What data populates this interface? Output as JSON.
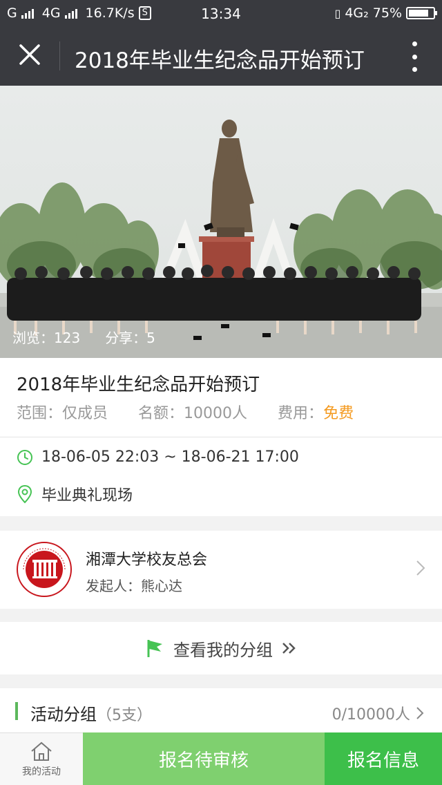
{
  "status_bar": {
    "carrier_1": "G",
    "carrier_2": "4G",
    "speed": "16.7K/s",
    "time": "13:34",
    "network": "4G₂",
    "battery": "75%",
    "battery_level": 0.75
  },
  "nav": {
    "title": "2018年毕业生纪念品开始预订"
  },
  "hero": {
    "views": "浏览：123",
    "shares": "分享：5"
  },
  "event": {
    "title": "2018年毕业生纪念品开始预订",
    "scope_label": "范围：",
    "scope_value": "仅成员",
    "quota_label": "名额：",
    "quota_value": "10000人",
    "fee_label": "费用：",
    "fee_value": "免费",
    "time_range": "18-06-05 22:03  ~  18-06-21 17:00",
    "location": "毕业典礼现场"
  },
  "organizer": {
    "name": "湘潭大学校友总会",
    "initiator": "发起人：熊心达"
  },
  "my_group": {
    "label": "查看我的分组"
  },
  "groups": {
    "label": "活动分组",
    "count": "（5支）",
    "quota": "0/10000人"
  },
  "bottom": {
    "my_activity": "我的活动",
    "pending": "报名待审核",
    "signup_info": "报名信息"
  },
  "colors": {
    "header": "#393a3f",
    "accent_green": "#3dbf4a",
    "light_green": "#7fd06f",
    "fee_orange": "#f49a1f"
  }
}
